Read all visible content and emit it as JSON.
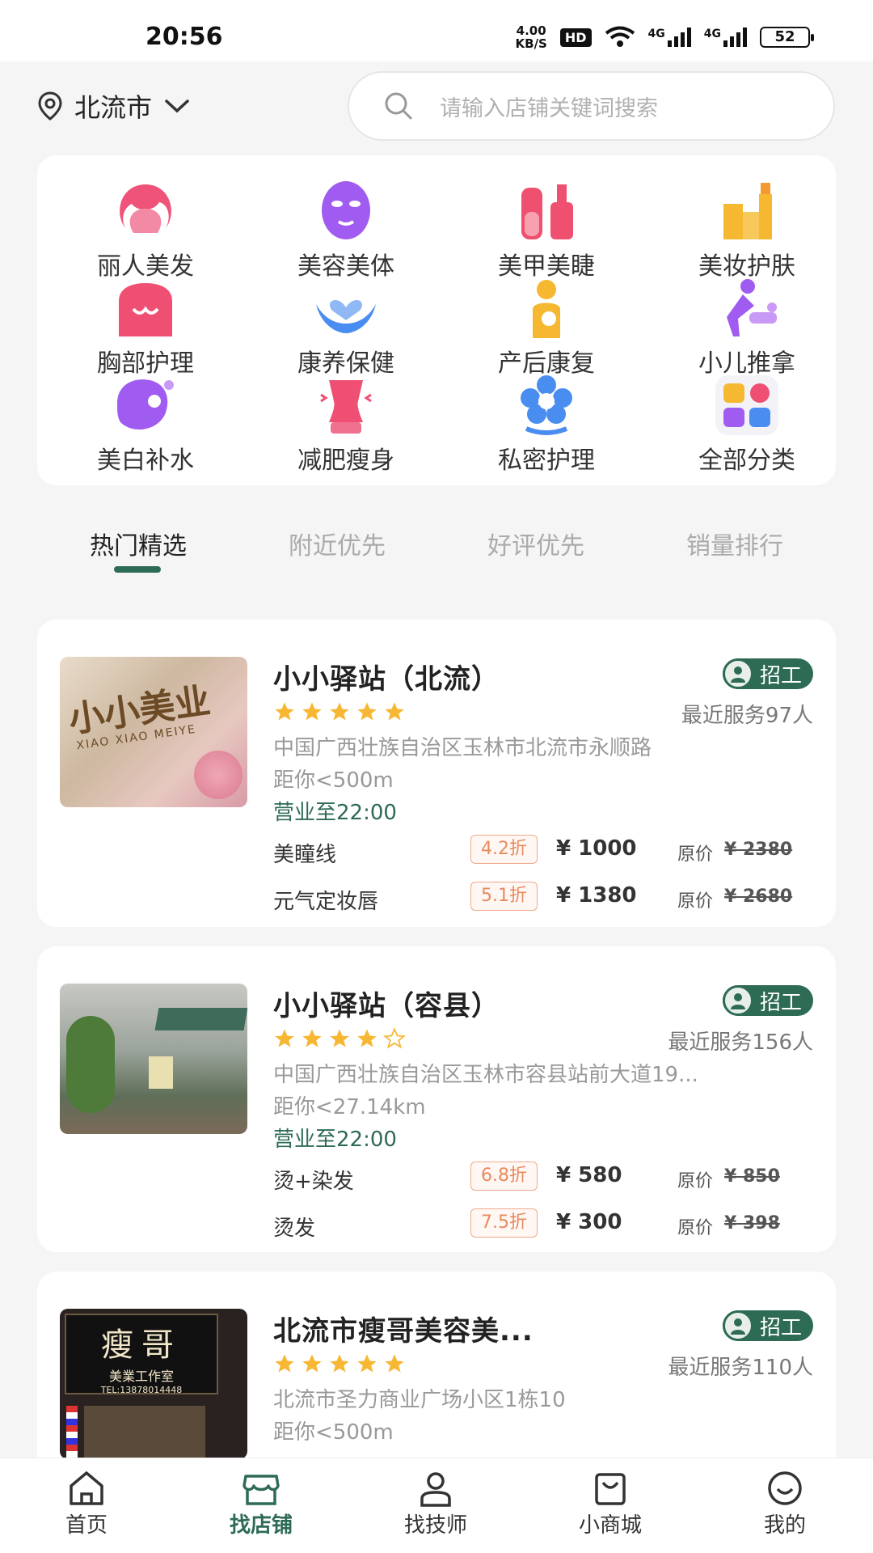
{
  "status_bar": {
    "time": "20:56",
    "speed_top": "4.00",
    "speed_bottom": "KB/S",
    "hd": "HD",
    "net1": "4G",
    "net2": "4G",
    "battery": "52"
  },
  "header": {
    "location": "北流市",
    "search_placeholder": "请输入店铺关键词搜索"
  },
  "categories": [
    {
      "label": "丽人美发",
      "icon": "hair-icon",
      "color": "#f0537a"
    },
    {
      "label": "美容美体",
      "icon": "face-mask-icon",
      "color": "#a05cf0"
    },
    {
      "label": "美甲美睫",
      "icon": "nail-polish-icon",
      "color": "#f05070"
    },
    {
      "label": "美妆护肤",
      "icon": "cosmetics-icon",
      "color": "#f5b830"
    },
    {
      "label": "胸部护理",
      "icon": "body-care-icon",
      "color": "#ef4f72"
    },
    {
      "label": "康养保健",
      "icon": "heart-hands-icon",
      "color": "#4a8df0"
    },
    {
      "label": "产后康复",
      "icon": "mother-baby-icon",
      "color": "#f5b830"
    },
    {
      "label": "小儿推拿",
      "icon": "baby-massage-icon",
      "color": "#a05cf0"
    },
    {
      "label": "美白补水",
      "icon": "whitening-icon",
      "color": "#a05cf0"
    },
    {
      "label": "减肥瘦身",
      "icon": "slimming-icon",
      "color": "#ef4f72"
    },
    {
      "label": "私密护理",
      "icon": "flower-icon",
      "color": "#4a8df0"
    },
    {
      "label": "全部分类",
      "icon": "all-categories-icon",
      "color": "#f5b830"
    }
  ],
  "tabs": [
    "热门精选",
    "附近优先",
    "好评优先",
    "销量排行"
  ],
  "stores": [
    {
      "name": "小小驿站（北流）",
      "hire_label": "招工",
      "rating": 5,
      "served": "最近服务97人",
      "address": "中国广西壮族自治区玉林市北流市永顺路",
      "distance": "距你<500m",
      "hours": "营业至22:00",
      "services": [
        {
          "name": "美瞳线",
          "discount": "4.2折",
          "price": "¥ 1000",
          "orig_label": "原价",
          "orig": "¥ 2380"
        },
        {
          "name": "元气定妆唇",
          "discount": "5.1折",
          "price": "¥ 1380",
          "orig_label": "原价",
          "orig": "¥ 2680"
        }
      ]
    },
    {
      "name": "小小驿站（容县）",
      "hire_label": "招工",
      "rating": 4,
      "served": "最近服务156人",
      "address": "中国广西壮族自治区玉林市容县站前大道19...",
      "distance": "距你<27.14km",
      "hours": "营业至22:00",
      "services": [
        {
          "name": "烫+染发",
          "discount": "6.8折",
          "price": "¥ 580",
          "orig_label": "原价",
          "orig": "¥ 850"
        },
        {
          "name": "烫发",
          "discount": "7.5折",
          "price": "¥ 300",
          "orig_label": "原价",
          "orig": "¥ 398"
        }
      ]
    },
    {
      "name": "北流市瘦哥美容美...",
      "hire_label": "招工",
      "rating": 5,
      "served": "最近服务110人",
      "address": "北流市圣力商业广场小区1栋10",
      "distance": "距你<500m",
      "photo_sign_title": "瘦哥",
      "photo_sign_sub": "美業工作室",
      "photo_sign_tel": "TEL:13878014448"
    }
  ],
  "photo1_sign": "小小美业",
  "photo1_sub": "XIAO XIAO MEIYE",
  "bottom_nav": [
    {
      "label": "首页",
      "icon": "home-icon"
    },
    {
      "label": "找店铺",
      "icon": "shop-icon",
      "active": true
    },
    {
      "label": "找技师",
      "icon": "person-icon"
    },
    {
      "label": "小商城",
      "icon": "bag-icon"
    },
    {
      "label": "我的",
      "icon": "smile-icon"
    }
  ],
  "colors": {
    "accent": "#2e6b55",
    "discount": "#e88a5e",
    "star": "#f7b733"
  }
}
